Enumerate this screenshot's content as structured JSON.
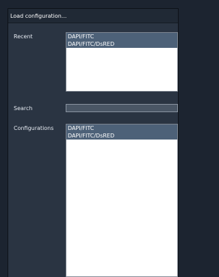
{
  "window": {
    "title": "Load configuration..."
  },
  "recent": {
    "label": "Recent",
    "items": [
      "DAPI/FITC",
      "DAPI/FITC/DsRED"
    ]
  },
  "search": {
    "label": "Search",
    "value": "",
    "placeholder": ""
  },
  "configurations": {
    "label": "Configurations",
    "items": [
      "DAPI/FITC",
      "DAPI/FITC/DsRED"
    ]
  }
}
